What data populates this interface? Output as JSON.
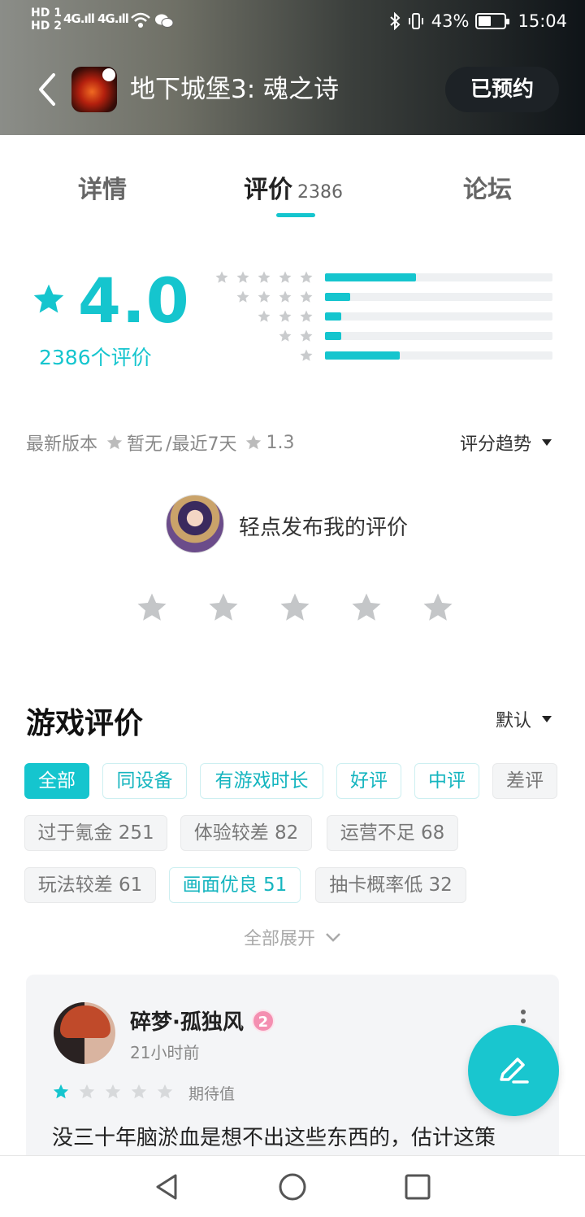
{
  "status_bar": {
    "hd1": "HD 1",
    "hd2": "HD 2",
    "signal1": "4G.ıll",
    "signal2": "4G.ıll",
    "battery_percent": "43%",
    "time": "15:04",
    "battery_level": 0.43
  },
  "header": {
    "game_title": "地下城堡3: 魂之诗",
    "reserved_label": "已预约"
  },
  "tabs": [
    {
      "label": "详情"
    },
    {
      "label": "评价",
      "count": "2386"
    },
    {
      "label": "论坛"
    }
  ],
  "rating": {
    "score": "4.0",
    "review_count_text": "2386个评价",
    "distribution": [
      {
        "stars": 5,
        "fraction": 0.4
      },
      {
        "stars": 4,
        "fraction": 0.11
      },
      {
        "stars": 3,
        "fraction": 0.07
      },
      {
        "stars": 2,
        "fraction": 0.07
      },
      {
        "stars": 1,
        "fraction": 0.33
      }
    ]
  },
  "version": {
    "latest_label": "最新版本",
    "latest_value": "暂无",
    "recent_label": "/最近7天",
    "recent_value": "1.3",
    "trend_label": "评分趋势"
  },
  "my_rating": {
    "prompt": "轻点发布我的评价"
  },
  "reviews_section": {
    "title": "游戏评价",
    "sort_label": "默认",
    "filters": [
      {
        "label": "全部",
        "style": "active"
      },
      {
        "label": "同设备",
        "style": "teal"
      },
      {
        "label": "有游戏时长",
        "style": "teal"
      },
      {
        "label": "好评",
        "style": "teal"
      },
      {
        "label": "中评",
        "style": "teal"
      },
      {
        "label": "差评",
        "style": "gray"
      },
      {
        "label": "过于氪金 251",
        "style": "gray"
      },
      {
        "label": "体验较差 82",
        "style": "gray"
      },
      {
        "label": "运营不足 68",
        "style": "gray"
      },
      {
        "label": "玩法较差 61",
        "style": "gray"
      },
      {
        "label": "画面优良 51",
        "style": "teal"
      },
      {
        "label": "抽卡概率低 32",
        "style": "gray"
      }
    ],
    "expand_label": "全部展开"
  },
  "review": {
    "user_name": "碎梦·孤独风",
    "level": "2",
    "time": "21小时前",
    "stars": 1,
    "tag": "期待值",
    "text": "没三十年脑淤血是想不出这些东西的，估计这策"
  },
  "colors": {
    "accent": "#15c5ce",
    "header_dark": "#1d2226"
  },
  "icons": {
    "back": "chevron-left-icon",
    "star": "star-icon",
    "dropdown": "caret-down-icon",
    "expand": "chevron-down-icon",
    "fab": "pen-icon",
    "nav_back": "triangle-back-icon",
    "nav_home": "circle-home-icon",
    "nav_recent": "square-recent-icon"
  }
}
